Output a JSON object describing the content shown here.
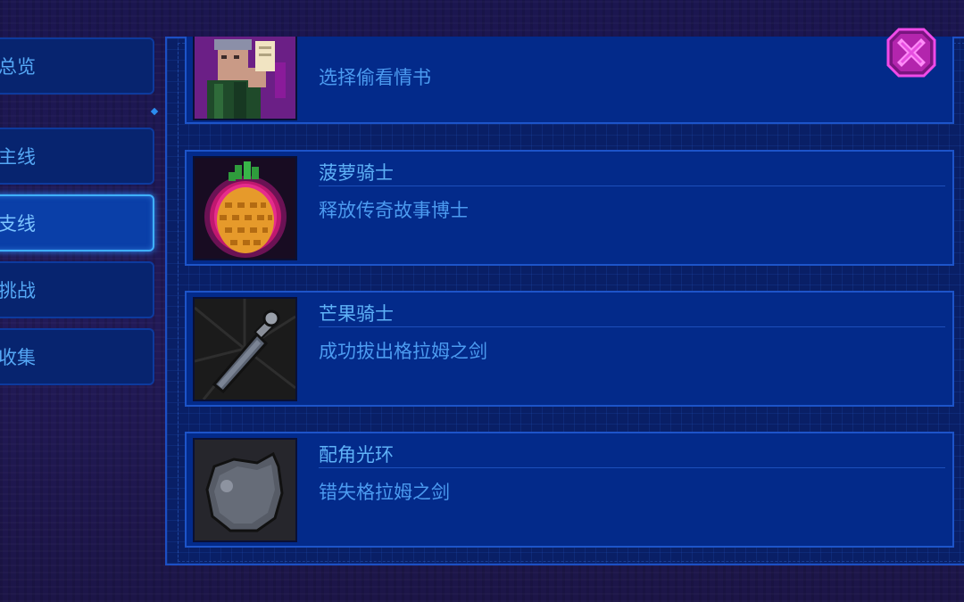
{
  "sidebar": {
    "tabs": [
      {
        "label": "总览"
      },
      {
        "label": "主线"
      },
      {
        "label": "支线"
      },
      {
        "label": "挑战"
      },
      {
        "label": "收集"
      }
    ],
    "active_tab": "支线"
  },
  "achievements": [
    {
      "title": "",
      "description": "选择偷看情书",
      "icon": "character-reading-letter-icon"
    },
    {
      "title": "菠萝骑士",
      "description": "释放传奇故事博士",
      "icon": "pineapple-icon"
    },
    {
      "title": "芒果骑士",
      "description": "成功拔出格拉姆之剑",
      "icon": "sword-icon"
    },
    {
      "title": "配角光环",
      "description": "错失格拉姆之剑",
      "icon": "gray-blob-icon"
    }
  ],
  "close_button": {
    "icon": "close-x-icon"
  },
  "colors": {
    "accent": "#3fb0ff",
    "text": "#5fb2f7",
    "card": "#032a8a",
    "close": "#d52fd0"
  }
}
